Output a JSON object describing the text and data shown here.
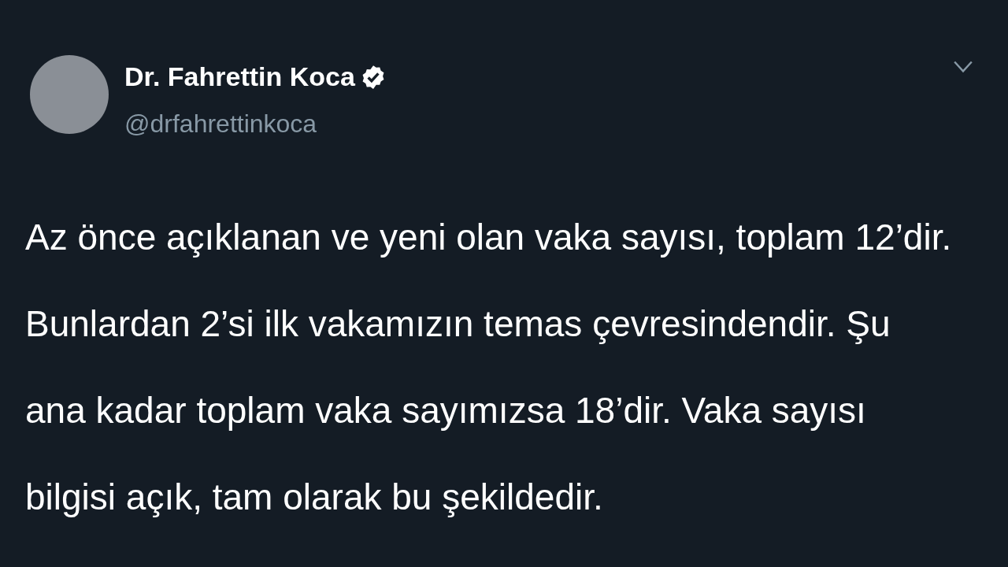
{
  "tweet": {
    "author": {
      "name": "Dr. Fahrettin Koca",
      "verified": true,
      "handle": "@drfahrettinkoca"
    },
    "text": "Az önce açıklanan ve yeni olan vaka sayısı, toplam 12’dir. Bunlardan 2’si ilk vakamızın temas çevresindendir. Şu ana kadar toplam vaka sayımızsa 18’dir. Vaka sayısı bilgisi açık, tam olarak bu şekildedir."
  }
}
